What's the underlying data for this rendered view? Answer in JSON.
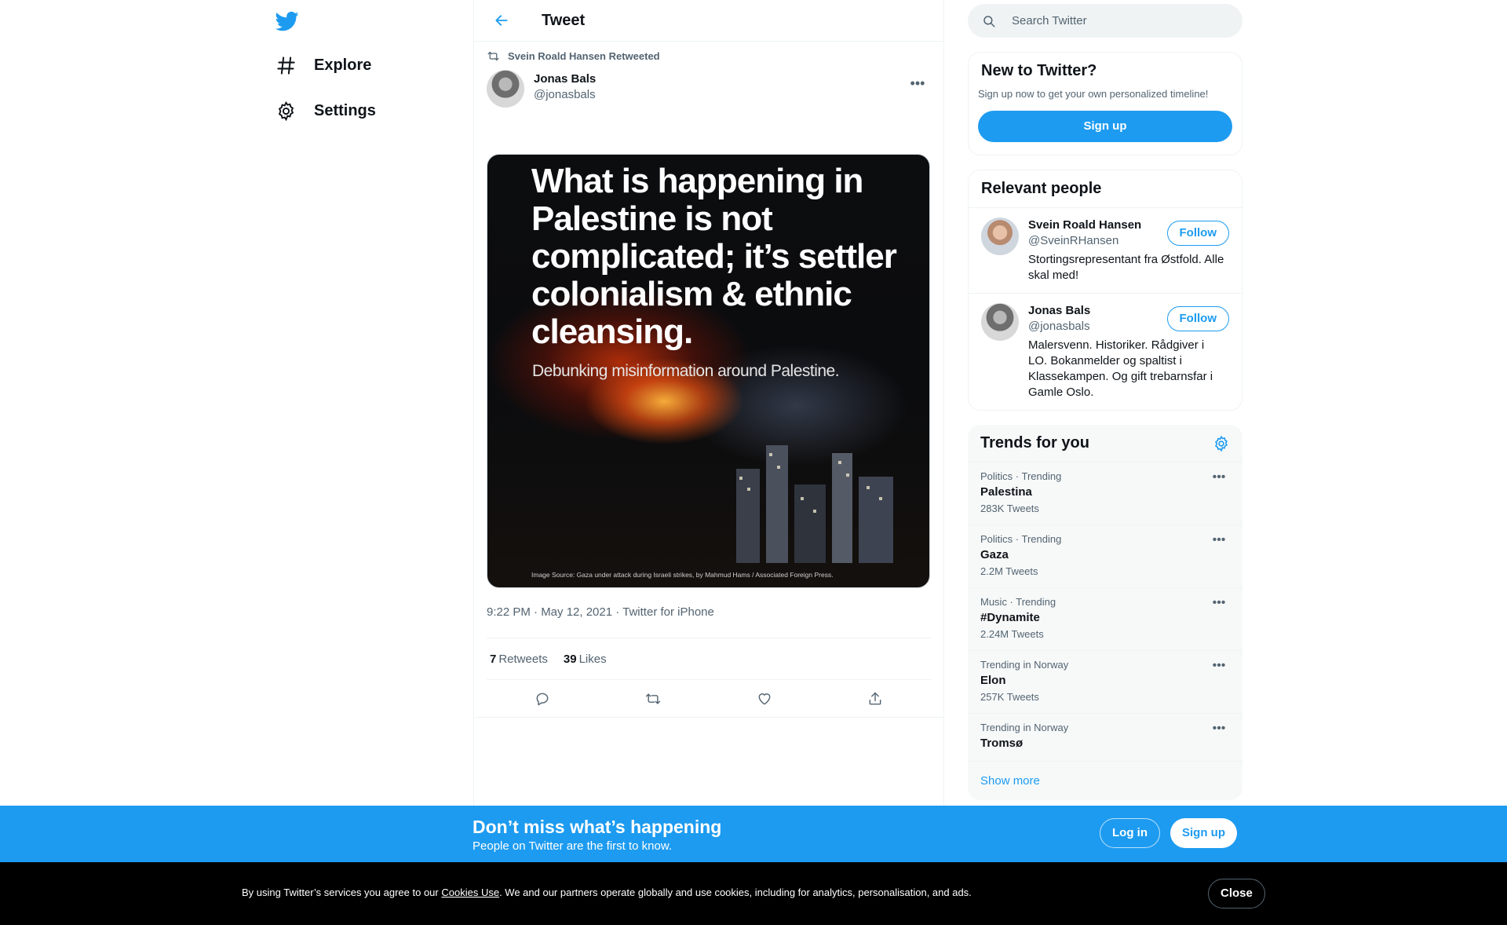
{
  "nav": {
    "items": [
      {
        "label": "Explore",
        "icon": "hashtag-icon"
      },
      {
        "label": "Settings",
        "icon": "gear-icon"
      }
    ]
  },
  "header": {
    "title": "Tweet"
  },
  "tweet": {
    "retweeted_by": "Svein Roald Hansen Retweeted",
    "author_name": "Jonas Bals",
    "author_handle": "@jonasbals",
    "image_headline": "What is happening in Palestine is not complicated; it’s settler colonialism & ethnic cleansing.",
    "image_subtitle": "Debunking misinformation around Palestine.",
    "image_source": "Image Source: Gaza under attack during Israeli strikes, by Mahmud Hams / Associated Foreign Press.",
    "timestamp": "9:22 PM · May 12, 2021 · Twitter for iPhone",
    "retweets_count": "7",
    "retweets_label": "Retweets",
    "likes_count": "39",
    "likes_label": "Likes"
  },
  "search": {
    "placeholder": "Search Twitter"
  },
  "new_to_twitter": {
    "title": "New to Twitter?",
    "desc": "Sign up now to get your own personalized timeline!",
    "signup_label": "Sign up"
  },
  "relevant_people": {
    "title": "Relevant people",
    "people": [
      {
        "name": "Svein Roald Hansen",
        "handle": "@SveinRHansen",
        "bio": "Stortingsrepresentant fra Østfold. Alle skal med!",
        "follow_label": "Follow"
      },
      {
        "name": "Jonas Bals",
        "handle": "@jonasbals",
        "bio": "Malersvenn. Historiker. Rådgiver i LO. Bokanmelder og spaltist i Klassekampen. Og gift trebarnsfar i Gamle Oslo.",
        "follow_label": "Follow"
      }
    ]
  },
  "trends": {
    "title": "Trends for you",
    "items": [
      {
        "meta": "Politics · Trending",
        "name": "Palestina",
        "count": "283K Tweets"
      },
      {
        "meta": "Politics · Trending",
        "name": "Gaza",
        "count": "2.2M Tweets"
      },
      {
        "meta": "Music · Trending",
        "name": "#Dynamite",
        "count": "2.24M Tweets"
      },
      {
        "meta": "Trending in Norway",
        "name": "Elon",
        "count": "257K Tweets"
      },
      {
        "meta": "Trending in Norway",
        "name": "Tromsø",
        "count": ""
      }
    ],
    "show_more": "Show more"
  },
  "login_banner": {
    "title": "Don’t miss what’s happening",
    "subtitle": "People on Twitter are the first to know.",
    "login_label": "Log in",
    "signup_label": "Sign up"
  },
  "cookie": {
    "text_before": "By using Twitter’s services you agree to our ",
    "link": "Cookies Use",
    "text_after": ". We and our partners operate globally and use cookies, including for analytics, personalisation, and ads.",
    "close_label": "Close"
  },
  "colors": {
    "accent": "#1d9bf0",
    "text": "#0f1419",
    "secondary": "#536471"
  }
}
